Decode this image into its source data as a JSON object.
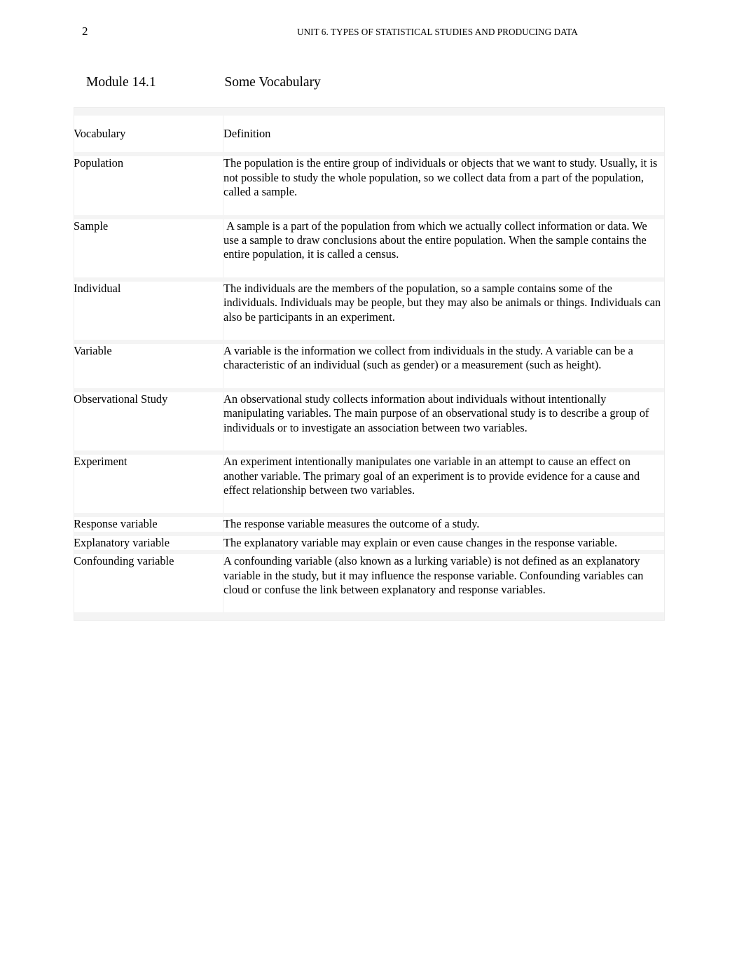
{
  "page": {
    "number": "2",
    "running_head": "UNIT 6. TYPES OF STATISTICAL STUDIES AND PRODUCING DATA"
  },
  "heading": {
    "module_label": "Module 14.1",
    "module_title": "Some Vocabulary"
  },
  "table": {
    "headers": {
      "term": "Vocabulary",
      "definition": "Definition"
    },
    "rows": [
      {
        "term": "Population",
        "definition": "The population is the entire group of individuals or objects that we want to study. Usually, it is not possible to study the whole population, so we collect data from a part of the population, called a sample."
      },
      {
        "term": "Sample",
        "definition": " A sample is a part of the population from which we actually collect information or data. We use a sample to draw conclusions about the entire population. When the sample contains the entire population, it is called a census."
      },
      {
        "term": "Individual",
        "definition": "The individuals are the members of the population, so a sample contains some of the individuals. Individuals may be people, but they may also be animals or things. Individuals can also be participants in an experiment."
      },
      {
        "term": "Variable",
        "definition": "A variable is the information we collect from individuals in the study. A variable can be a characteristic of an individual (such as gender) or a measurement (such as height)."
      },
      {
        "term": "Observational Study",
        "definition": "An observational study collects information about individuals without intentionally manipulating variables. The main purpose of an observational study is to describe a group of individuals or to investigate an association between two variables."
      },
      {
        "term": "Experiment",
        "definition": "An experiment intentionally manipulates one variable in an attempt to cause an effect on another variable. The primary goal of an experiment is to provide evidence for a cause and effect relationship between two variables."
      },
      {
        "term": "Response variable",
        "definition": "The response variable measures the outcome of a study."
      },
      {
        "term": "Explanatory variable",
        "definition": "The explanatory variable may explain or even cause changes in the response variable."
      },
      {
        "term": "Confounding variable",
        "definition": "A confounding variable (also known as a lurking variable) is not defined as an explanatory variable in the study, but it may influence the response variable. Confounding variables can cloud or confuse the link between explanatory and response variables."
      }
    ]
  },
  "colors": {
    "page_background": "#ffffff",
    "table_gap": "#f4f4f4",
    "cell_background": "#ffffff",
    "text": "#000000"
  }
}
